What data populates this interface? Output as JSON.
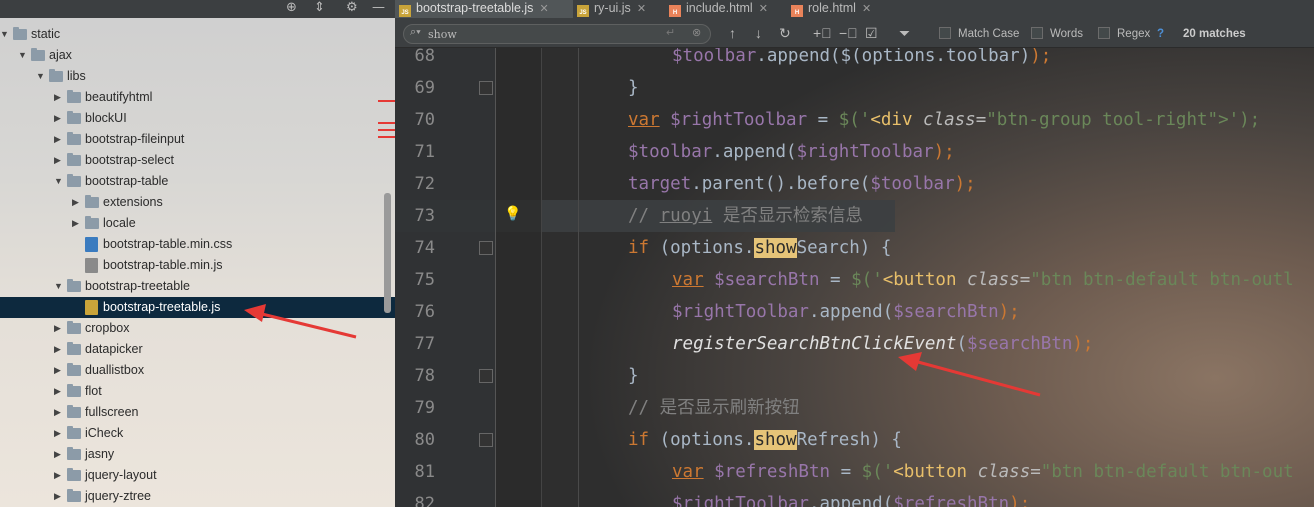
{
  "project_tree": {
    "items": [
      {
        "label": "static",
        "depth": 0,
        "expanded": true
      },
      {
        "label": "ajax",
        "depth": 1,
        "expanded": true
      },
      {
        "label": "libs",
        "depth": 2,
        "expanded": true
      },
      {
        "label": "beautifyhtml",
        "depth": 3,
        "expanded": false
      },
      {
        "label": "blockUI",
        "depth": 3,
        "expanded": false
      },
      {
        "label": "bootstrap-fileinput",
        "depth": 3,
        "expanded": false
      },
      {
        "label": "bootstrap-select",
        "depth": 3,
        "expanded": false
      },
      {
        "label": "bootstrap-table",
        "depth": 3,
        "expanded": true
      },
      {
        "label": "extensions",
        "depth": 4,
        "expanded": false
      },
      {
        "label": "locale",
        "depth": 4,
        "expanded": false
      },
      {
        "label": "bootstrap-table.min.css",
        "depth": 4,
        "file": "css"
      },
      {
        "label": "bootstrap-table.min.js",
        "depth": 4,
        "file": "minjs"
      },
      {
        "label": "bootstrap-treetable",
        "depth": 3,
        "expanded": true
      },
      {
        "label": "bootstrap-treetable.js",
        "depth": 4,
        "file": "js",
        "selected": true
      },
      {
        "label": "cropbox",
        "depth": 3,
        "expanded": false
      },
      {
        "label": "datapicker",
        "depth": 3,
        "expanded": false
      },
      {
        "label": "duallistbox",
        "depth": 3,
        "expanded": false
      },
      {
        "label": "flot",
        "depth": 3,
        "expanded": false
      },
      {
        "label": "fullscreen",
        "depth": 3,
        "expanded": false
      },
      {
        "label": "iCheck",
        "depth": 3,
        "expanded": false
      },
      {
        "label": "jasny",
        "depth": 3,
        "expanded": false
      },
      {
        "label": "jquery-layout",
        "depth": 3,
        "expanded": false
      },
      {
        "label": "jquery-ztree",
        "depth": 3,
        "expanded": false
      }
    ]
  },
  "tabs": [
    {
      "label": "bootstrap-treetable.js",
      "icon": "JS",
      "active": true
    },
    {
      "label": "ry-ui.js",
      "icon": "JS",
      "active": false
    },
    {
      "label": "include.html",
      "icon": "H",
      "active": false
    },
    {
      "label": "role.html",
      "icon": "H",
      "active": false
    }
  ],
  "search": {
    "query": "show",
    "match_case_label": "Match Case",
    "words_label": "Words",
    "regex_label": "Regex",
    "help": "?",
    "matches": "20 matches"
  },
  "line_numbers": [
    "68",
    "69",
    "70",
    "71",
    "72",
    "73",
    "74",
    "75",
    "76",
    "77",
    "78",
    "79",
    "80",
    "81",
    "82"
  ],
  "code": {
    "l68": [
      "$toolbar",
      ".append(",
      "$(options.toolbar)",
      ");"
    ],
    "l69": "}",
    "l70": {
      "kw": "var",
      "name": " $rightToolbar",
      "eq": " = ",
      "call": "$('",
      "tag": "<div",
      "attr": " class=",
      "val": "\"btn-group tool-right\"",
      "end": ">');"
    },
    "l71": {
      "obj": "$toolbar",
      "m": ".append(",
      "arg": "$rightToolbar",
      "end": ");"
    },
    "l72": {
      "obj": "target",
      "m1": ".parent()",
      "m2": ".before(",
      "arg": "$toolbar",
      "end": ");"
    },
    "l73": {
      "c1": "// ",
      "c2": "ruoyi",
      "c3": " 是否显示检索信息"
    },
    "l74": {
      "kw": "if",
      "p1": " (options.",
      "hl": "show",
      "p2": "Search) {"
    },
    "l75": {
      "kw": "var",
      "name": " $searchBtn",
      "eq": " = ",
      "call": "$('",
      "tag": "<button",
      "attr": " class=",
      "val": "\"btn btn-default btn-outl"
    },
    "l76": {
      "obj": "$rightToolbar",
      "m": ".append(",
      "arg": "$searchBtn",
      "end": ");"
    },
    "l77": {
      "fn": "registerSearchBtnClickEvent",
      "p": "(",
      "arg": "$searchBtn",
      "end": ");"
    },
    "l78": "}",
    "l79": "// 是否显示刷新按钮",
    "l80": {
      "kw": "if",
      "p1": " (options.",
      "hl": "show",
      "p2": "Refresh) {"
    },
    "l81": {
      "kw": "var",
      "name": " $refreshBtn",
      "eq": " = ",
      "call": "$('",
      "tag": "<button",
      "attr": " class=",
      "val": "\"btn btn-default btn-out"
    },
    "l82": {
      "obj": "$rightToolbar",
      "m": ".append(",
      "arg": "$refreshBtn",
      "end": ");"
    }
  },
  "colors": {
    "keyword": "#cc7832",
    "variable": "#9876aa",
    "string": "#6a8759",
    "tag": "#e8bf6a",
    "comment": "#808080",
    "highlight": "#e6c478",
    "annotation_arrow": "#e53935"
  }
}
